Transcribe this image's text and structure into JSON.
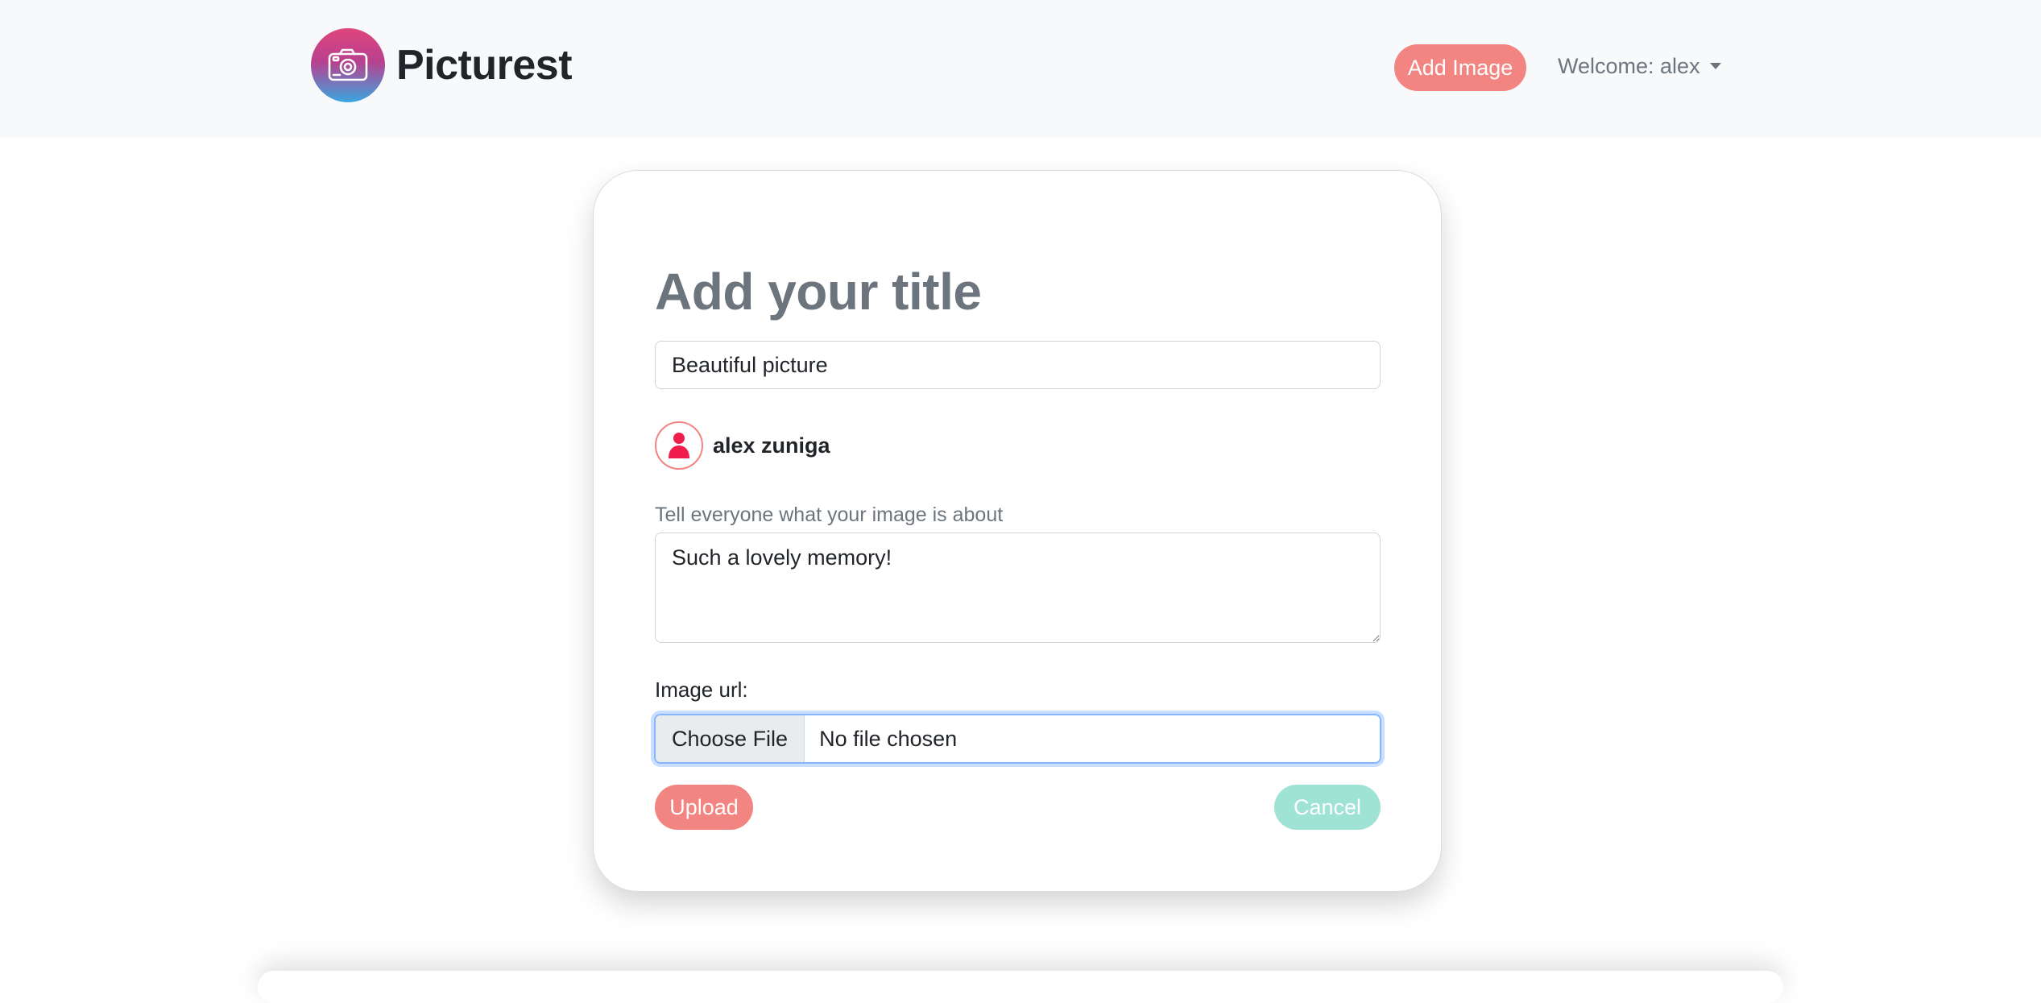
{
  "navbar": {
    "brand_name": "Picturest",
    "logo_icon": "camera-icon",
    "add_image_label": "Add Image",
    "welcome_label": "Welcome: alex"
  },
  "form": {
    "heading": "Add your title",
    "title_value": "Beautiful picture",
    "author_name": "alex zuniga",
    "author_icon": "user-icon",
    "description_label": "Tell everyone what your image is about",
    "description_value": "Such a lovely memory!",
    "image_url_label": "Image url:",
    "choose_file_label": "Choose File",
    "file_status": "No file chosen",
    "upload_label": "Upload",
    "cancel_label": "Cancel"
  },
  "colors": {
    "accent": "#f28482",
    "secondary_button": "#9ee3d4",
    "navbar_bg": "#f8f9fa",
    "heading_text": "#6c757d",
    "focus_ring": "#86b7fe"
  }
}
